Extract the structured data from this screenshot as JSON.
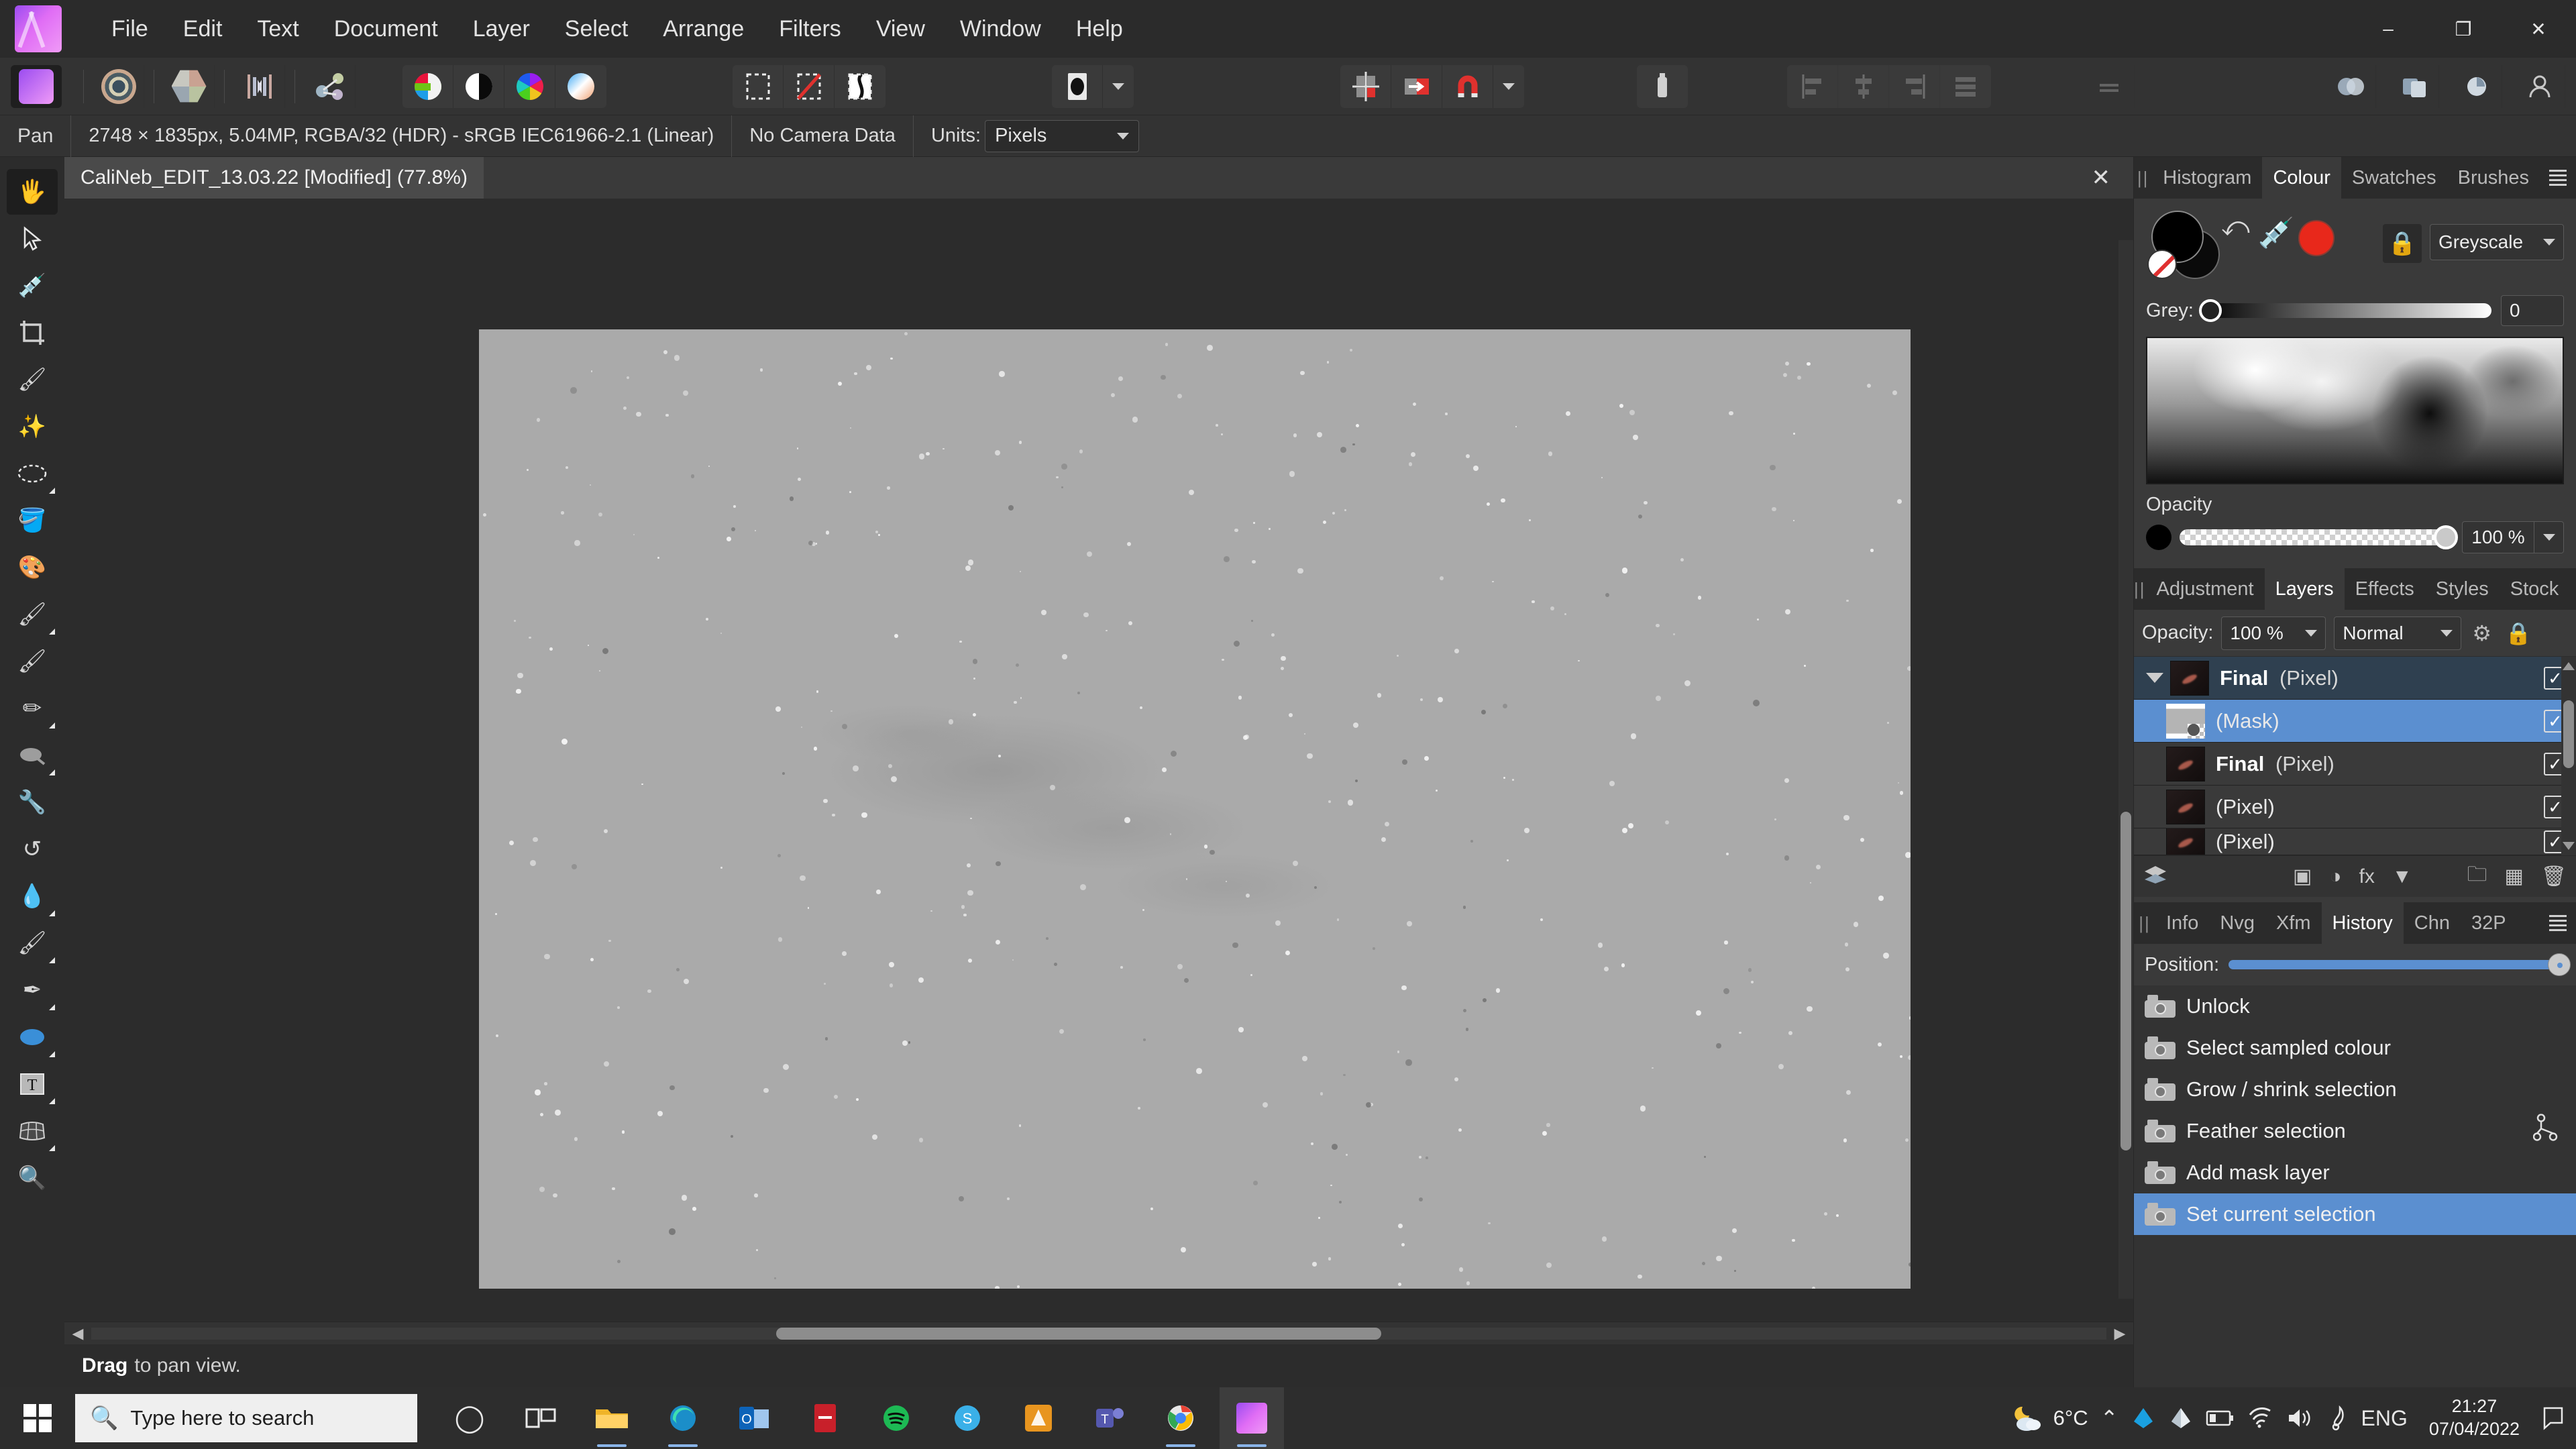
{
  "app": {
    "name": "Affinity Photo",
    "logo_icon": "affinity-photo-logo"
  },
  "menubar": {
    "items": [
      "File",
      "Edit",
      "Text",
      "Document",
      "Layer",
      "Select",
      "Arrange",
      "Filters",
      "View",
      "Window",
      "Help"
    ]
  },
  "window_controls": {
    "minimize": "–",
    "maximize": "❐",
    "close": "✕"
  },
  "toolbar": {
    "personas": [
      {
        "name": "photo-persona",
        "icon": "affinity-photo-persona-icon"
      },
      {
        "name": "liquify-persona",
        "icon": "liquify-persona-icon"
      },
      {
        "name": "develop-persona",
        "icon": "develop-persona-icon"
      },
      {
        "name": "tone-mapping-persona",
        "icon": "tone-mapping-persona-icon"
      },
      {
        "name": "export-persona",
        "icon": "export-persona-icon"
      }
    ],
    "adjustments": [
      {
        "name": "colour-wheel-split-icon",
        "icon": "split-colour-icon"
      },
      {
        "name": "contrast-icon",
        "icon": "black-white-circle-icon"
      },
      {
        "name": "hue-wheel-icon",
        "icon": "rainbow-wheel-icon"
      },
      {
        "name": "gradient-sphere-icon",
        "icon": "gradient-ball-icon"
      }
    ],
    "selection": [
      {
        "name": "marquee-select-icon",
        "icon": "dashed-rect-icon"
      },
      {
        "name": "deselect-icon",
        "icon": "dashed-rect-slash-icon"
      },
      {
        "name": "refine-selection-icon",
        "icon": "refine-edge-icon"
      }
    ],
    "preview": {
      "name": "preview-mode-icon",
      "icon": "ellipse-preview-icon"
    },
    "snapping": [
      {
        "name": "show-grid-icon",
        "icon": "grid-icon"
      },
      {
        "name": "snap-to-icon",
        "icon": "snap-arrow-icon"
      },
      {
        "name": "magnet-snapping-icon",
        "icon": "magnet-icon"
      }
    ],
    "assistant": {
      "name": "assistant-icon",
      "icon": "assistant-icon"
    },
    "align": [
      {
        "name": "align-left-icon",
        "icon": "align-left-icon"
      },
      {
        "name": "align-center-icon",
        "icon": "align-center-icon"
      },
      {
        "name": "align-right-icon",
        "icon": "align-right-icon"
      },
      {
        "name": "align-distribute-icon",
        "icon": "distribute-icon"
      }
    ],
    "more": {
      "name": "more-options-icon",
      "icon": "ellipsis-icon"
    },
    "right_icons": [
      {
        "name": "colour-panel-toggle-icon",
        "icon": "colour-circles-icon"
      },
      {
        "name": "layers-panel-toggle-icon",
        "icon": "layers-stack-icon"
      },
      {
        "name": "history-panel-toggle-icon",
        "icon": "pie-history-icon"
      }
    ],
    "account": {
      "name": "account-icon",
      "icon": "person-icon"
    }
  },
  "context_bar": {
    "tool_name": "Pan",
    "document_info": "2748 × 1835px, 5.04MP, RGBA/32 (HDR) - sRGB IEC61966-2.1 (Linear)",
    "camera_data": "No Camera Data",
    "units_label": "Units:",
    "units_value": "Pixels"
  },
  "document_tab": {
    "title": "CaliNeb_EDIT_13.03.22 [Modified] (77.8%)",
    "close_icon": "✕"
  },
  "tools": [
    {
      "name": "pan-tool",
      "icon": "hand-icon",
      "glyph": "🖐",
      "active": true,
      "submenu": false
    },
    {
      "name": "move-tool",
      "icon": "arrow-cursor-icon",
      "glyph": "➤",
      "active": false,
      "submenu": false
    },
    {
      "name": "colour-picker-tool",
      "icon": "eyedropper-icon",
      "glyph": "💉",
      "active": false,
      "submenu": false
    },
    {
      "name": "crop-tool",
      "icon": "crop-icon",
      "glyph": "⌗",
      "active": false,
      "submenu": false
    },
    {
      "name": "selection-brush-tool",
      "icon": "selection-brush-icon",
      "glyph": "🖌",
      "active": false,
      "submenu": false
    },
    {
      "name": "flood-select-tool",
      "icon": "magic-wand-icon",
      "glyph": "✨",
      "active": false,
      "submenu": false
    },
    {
      "name": "elliptical-marquee-tool",
      "icon": "ellipse-marquee-icon",
      "glyph": "⬭",
      "active": false,
      "submenu": true
    },
    {
      "name": "flood-fill-tool",
      "icon": "paint-bucket-icon",
      "glyph": "🪣",
      "active": false,
      "submenu": false
    },
    {
      "name": "colour-replacement-tool",
      "icon": "colour-wheel-brush-icon",
      "glyph": "🎨",
      "active": false,
      "submenu": false
    },
    {
      "name": "paint-brush-tool",
      "icon": "paint-brush-icon",
      "glyph": "🖌",
      "active": false,
      "submenu": true
    },
    {
      "name": "paint-mixer-tool",
      "icon": "paint-mixer-icon",
      "glyph": "🖌",
      "active": false,
      "submenu": false
    },
    {
      "name": "erase-brush-tool",
      "icon": "eraser-icon",
      "glyph": "✏",
      "active": false,
      "submenu": true
    },
    {
      "name": "dodge-burn-tool",
      "icon": "dodge-icon",
      "glyph": "⬭",
      "active": false,
      "submenu": true
    },
    {
      "name": "clone-brush-tool",
      "icon": "clone-stamp-icon",
      "glyph": "🔧",
      "active": false,
      "submenu": false
    },
    {
      "name": "undo-brush-tool",
      "icon": "undo-brush-icon",
      "glyph": "↺",
      "active": false,
      "submenu": false
    },
    {
      "name": "blur-brush-tool",
      "icon": "water-drop-icon",
      "glyph": "💧",
      "active": false,
      "submenu": true
    },
    {
      "name": "smudge-brush-tool",
      "icon": "smudge-brush-icon",
      "glyph": "🖌",
      "active": false,
      "submenu": true
    },
    {
      "name": "pen-tool",
      "icon": "pen-nib-icon",
      "glyph": "✒",
      "active": false,
      "submenu": true
    },
    {
      "name": "ellipse-shape-tool",
      "icon": "ellipse-shape-icon",
      "glyph": "⬬",
      "active": false,
      "submenu": true
    },
    {
      "name": "artistic-text-tool",
      "icon": "text-frame-icon",
      "glyph": "T",
      "active": false,
      "submenu": true
    },
    {
      "name": "mesh-warp-tool",
      "icon": "mesh-warp-icon",
      "glyph": "▦",
      "active": false,
      "submenu": true
    },
    {
      "name": "zoom-tool",
      "icon": "magnifier-icon",
      "glyph": "🔍",
      "active": false,
      "submenu": false
    }
  ],
  "status_bar": {
    "bold": "Drag",
    "text": "to pan view."
  },
  "colour_panel": {
    "tabs": [
      {
        "label": "Histogram",
        "active": false
      },
      {
        "label": "Colour",
        "active": true
      },
      {
        "label": "Swatches",
        "active": false
      },
      {
        "label": "Brushes",
        "active": false
      }
    ],
    "menu_icon": "panel-menu-icon",
    "swap_icon": "swap-colours-icon",
    "picker_icon": "eyedropper-icon",
    "recent_chip_colour": "#e8281b",
    "lock_icon": "lock-icon",
    "mode": "Greyscale",
    "grey_label": "Grey:",
    "grey_value": "0",
    "opacity_label": "Opacity",
    "opacity_value": "100 %"
  },
  "layers_panel": {
    "tabs": [
      {
        "label": "Adjustment",
        "active": false
      },
      {
        "label": "Layers",
        "active": true
      },
      {
        "label": "Effects",
        "active": false
      },
      {
        "label": "Styles",
        "active": false
      },
      {
        "label": "Stock",
        "active": false
      }
    ],
    "menu_icon": "panel-menu-icon",
    "opacity_label": "Opacity:",
    "opacity_value": "100 %",
    "blend_mode": "Normal",
    "gear_icon": "gear-icon",
    "lock_icon": "lock-icon",
    "layers": [
      {
        "name": "Final",
        "type": "(Pixel)",
        "selected": false,
        "group": true,
        "indent": 0,
        "thumb": "dark",
        "checked": true,
        "disclosure": true
      },
      {
        "name": "",
        "type": "(Mask)",
        "selected": true,
        "group": false,
        "indent": 1,
        "thumb": "mask",
        "checked": true,
        "disclosure": false
      },
      {
        "name": "Final",
        "type": "(Pixel)",
        "selected": false,
        "group": false,
        "indent": 0,
        "thumb": "dark",
        "checked": true,
        "disclosure": false
      },
      {
        "name": "",
        "type": "(Pixel)",
        "selected": false,
        "group": false,
        "indent": 0,
        "thumb": "dark",
        "checked": true,
        "disclosure": false
      },
      {
        "name": "",
        "type": "(Pixel)",
        "selected": false,
        "group": false,
        "indent": 0,
        "thumb": "dark",
        "checked": true,
        "disclosure": false
      }
    ],
    "footer_icons": [
      {
        "name": "layers-stack-icon",
        "glyph": "≣"
      },
      {
        "name": "mask-layer-icon",
        "glyph": "▣"
      },
      {
        "name": "adjustment-layer-icon",
        "glyph": "◑"
      },
      {
        "name": "live-filter-layer-icon",
        "glyph": "fx"
      },
      {
        "name": "live-filter-icon",
        "glyph": "▼"
      },
      {
        "name": "new-group-icon",
        "glyph": "📁"
      },
      {
        "name": "new-pixel-layer-icon",
        "glyph": "▦"
      },
      {
        "name": "delete-layer-icon",
        "glyph": "🗑"
      }
    ]
  },
  "history_panel": {
    "tabs": [
      {
        "label": "Info",
        "active": false
      },
      {
        "label": "Nvg",
        "active": false
      },
      {
        "label": "Xfm",
        "active": false
      },
      {
        "label": "History",
        "active": true
      },
      {
        "label": "Chn",
        "active": false
      },
      {
        "label": "32P",
        "active": false
      }
    ],
    "menu_icon": "panel-menu-icon",
    "position_label": "Position:",
    "items": [
      {
        "label": "Unlock",
        "selected": false,
        "branch": false
      },
      {
        "label": "Select sampled colour",
        "selected": false,
        "branch": false
      },
      {
        "label": "Grow / shrink selection",
        "selected": false,
        "branch": false
      },
      {
        "label": "Feather selection",
        "selected": false,
        "branch": true
      },
      {
        "label": "Add mask layer",
        "selected": false,
        "branch": false
      },
      {
        "label": "Set current selection",
        "selected": true,
        "branch": false
      }
    ]
  },
  "taskbar": {
    "start_icon": "windows-start-icon",
    "search_placeholder": "Type here to search",
    "search_icon": "search-icon",
    "items": [
      {
        "name": "cortana-icon",
        "glyph": "◯",
        "running": false,
        "active": false
      },
      {
        "name": "task-view-icon",
        "glyph": "⌸",
        "running": false,
        "active": false
      },
      {
        "name": "file-explorer-icon",
        "glyph": "📁",
        "running": true,
        "active": false
      },
      {
        "name": "edge-browser-icon",
        "glyph": "🌀",
        "running": true,
        "active": false
      },
      {
        "name": "outlook-icon",
        "glyph": "✉",
        "running": false,
        "active": false
      },
      {
        "name": "pdf-reader-icon",
        "glyph": "▮",
        "running": false,
        "active": false
      },
      {
        "name": "spotify-icon",
        "glyph": "♫",
        "running": false,
        "active": false
      },
      {
        "name": "skype-icon",
        "glyph": "Ⓢ",
        "running": false,
        "active": false
      },
      {
        "name": "affinity-designer-icon",
        "glyph": "◆",
        "running": false,
        "active": false
      },
      {
        "name": "teams-icon",
        "glyph": "Ⓣ",
        "running": false,
        "active": false
      },
      {
        "name": "chrome-icon",
        "glyph": "●",
        "running": true,
        "active": false
      },
      {
        "name": "affinity-photo-taskbar-icon",
        "glyph": "▲",
        "running": true,
        "active": true
      }
    ],
    "weather": {
      "icon": "partly-cloudy-night-icon",
      "temperature": "6°C"
    },
    "tray": [
      {
        "name": "show-hidden-icons-chevron",
        "glyph": "∧"
      },
      {
        "name": "onedrive-icon",
        "glyph": "☁"
      },
      {
        "name": "dropbox-icon",
        "glyph": "◇"
      },
      {
        "name": "battery-icon",
        "glyph": "▭"
      },
      {
        "name": "wifi-icon",
        "glyph": "◠"
      },
      {
        "name": "volume-icon",
        "glyph": "🔊"
      },
      {
        "name": "pen-settings-icon",
        "glyph": "✐"
      }
    ],
    "language": "ENG",
    "time": "21:27",
    "date": "07/04/2022",
    "notifications_icon": "notification-icon"
  },
  "colors": {
    "accent_blue": "#5b8fd0",
    "panel_bg": "#3a3a3a",
    "chrome_bg": "#2c2c2c",
    "canvas_grey": "#aaaaaa",
    "red_chip": "#e8281b"
  }
}
